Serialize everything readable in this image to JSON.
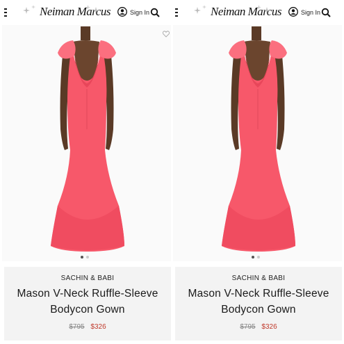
{
  "screens": [
    {
      "header": {
        "logo": "Neiman Marcus",
        "signin_label": "Sign In"
      },
      "product": {
        "brand": "SACHIN & BABI",
        "title": "Mason V-Neck Ruffle-Sleeve Bodycon Gown",
        "original_price": "$795",
        "sale_price": "$326"
      }
    },
    {
      "header": {
        "logo": "Neiman Marcus",
        "signin_label": "Sign In"
      },
      "product": {
        "brand": "SACHIN & BABI",
        "title": "Mason V-Neck Ruffle-Sleeve Bodycon Gown",
        "original_price": "$795",
        "sale_price": "$326"
      }
    }
  ],
  "icons": [
    "menu-icon",
    "sparkle-icon",
    "account-icon",
    "search-icon",
    "heart-icon"
  ],
  "colors": {
    "gown": "#f7586a",
    "skin": "#5a3a26",
    "sale_price": "#c0392b",
    "info_bg": "#f3f3f3"
  }
}
